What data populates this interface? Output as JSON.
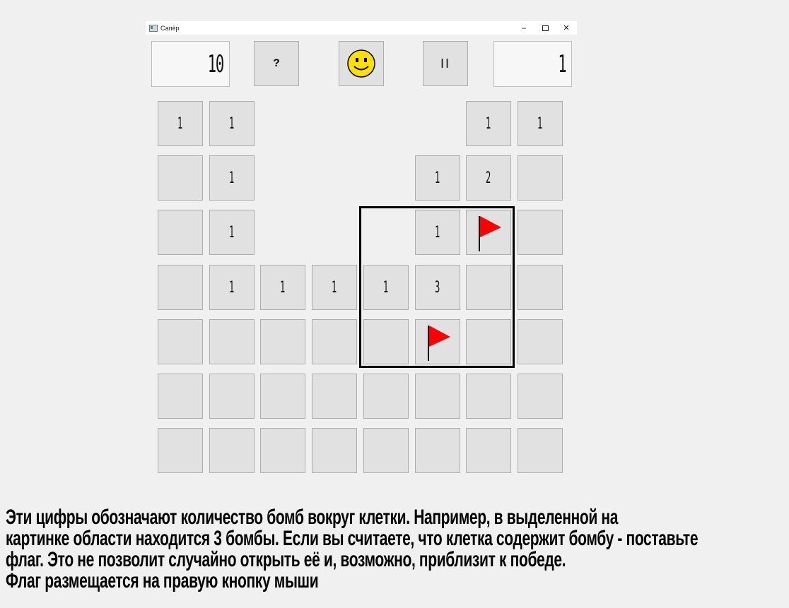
{
  "window": {
    "title": "Сапёр",
    "minimize": "–",
    "close": "✕"
  },
  "toolbar": {
    "mines_left": "10",
    "help_label": "?",
    "face": "smiley-face-icon",
    "pause_label": "II",
    "timer": "1"
  },
  "board": {
    "rows": 7,
    "cols": 8,
    "cells": [
      [
        "1",
        "1",
        "",
        "",
        "",
        "",
        "1",
        "1"
      ],
      [
        "",
        "1",
        "",
        "",
        "",
        "1",
        "2",
        ""
      ],
      [
        "",
        "1",
        "",
        "",
        "",
        "1",
        "F",
        ""
      ],
      [
        "",
        "1",
        "1",
        "1",
        "1",
        "3",
        "",
        ""
      ],
      [
        "",
        "",
        "",
        "",
        "",
        "F",
        "",
        ""
      ],
      [
        "",
        "",
        "",
        "",
        "",
        "",
        "",
        ""
      ],
      [
        "",
        "",
        "",
        "",
        "",
        "",
        "",
        ""
      ]
    ],
    "cell_state": [
      [
        "num",
        "num",
        "open",
        "open",
        "open",
        "open",
        "num",
        "num"
      ],
      [
        "closed",
        "num",
        "open",
        "open",
        "open",
        "num",
        "num",
        "closed"
      ],
      [
        "closed",
        "num",
        "open",
        "open",
        "open",
        "num",
        "flag",
        "closed"
      ],
      [
        "closed",
        "num",
        "num",
        "num",
        "num",
        "num",
        "closed",
        "closed"
      ],
      [
        "closed",
        "closed",
        "closed",
        "closed",
        "closed",
        "flag",
        "closed",
        "closed"
      ],
      [
        "closed",
        "closed",
        "closed",
        "closed",
        "closed",
        "closed",
        "closed",
        "closed"
      ],
      [
        "closed",
        "closed",
        "closed",
        "closed",
        "closed",
        "closed",
        "closed",
        "closed"
      ]
    ]
  },
  "colors": {
    "flag": "#ff0000",
    "smiley": "#ffe000",
    "cell_bg": "#e1e1e1",
    "cell_border": "#adadad",
    "background": "#f0f0f0"
  },
  "instructions": {
    "line1": "Эти цифры обозначают количество бомб вокруг клетки. Например, в выделенной на",
    "line2": "картинке области находится 3 бомбы. Если вы считаете, что клетка содержит бомбу - поставьте",
    "line3": "флаг. Это не позволит случайно открыть её и, возможно, приблизит к победе.",
    "line4": " Флаг размещается на правую кнопку мыши"
  }
}
